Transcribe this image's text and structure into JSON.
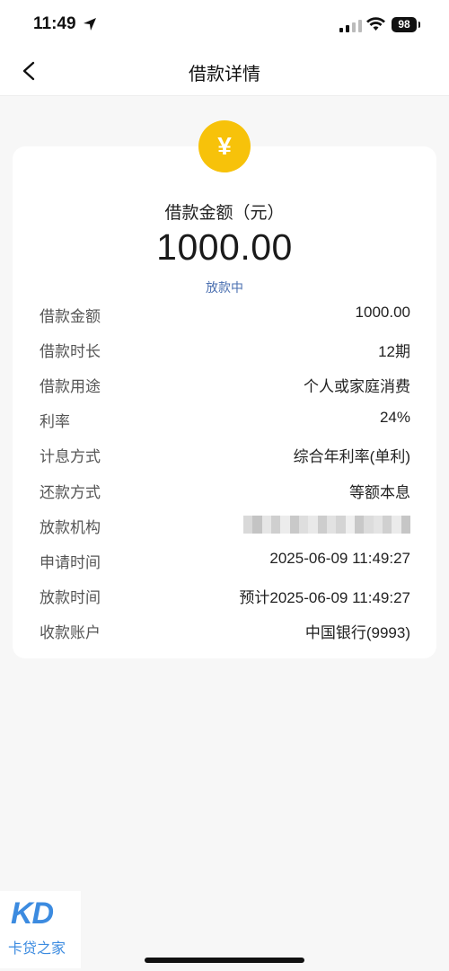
{
  "status": {
    "time": "11:49",
    "battery": "98",
    "location_icon": "location-arrow-icon",
    "signal_icon": "cellular-signal-icon",
    "wifi_icon": "wifi-icon"
  },
  "nav": {
    "title": "借款详情",
    "back_icon": "chevron-left-icon"
  },
  "loan": {
    "icon": "yen-coin-icon",
    "coin_symbol": "¥",
    "amount_label": "借款金额（元）",
    "amount": "1000.00",
    "status": "放款中"
  },
  "details": [
    {
      "label": "借款金额",
      "value": "1000.00"
    },
    {
      "label": "借款时长",
      "value": "12期"
    },
    {
      "label": "借款用途",
      "value": "个人或家庭消费"
    },
    {
      "label": "利率",
      "value": "24%"
    },
    {
      "label": "计息方式",
      "value": "综合年利率(单利)"
    },
    {
      "label": "还款方式",
      "value": "等额本息"
    },
    {
      "label": "放款机构",
      "value": ""
    },
    {
      "label": "申请时间",
      "value": "2025-06-09 11:49:27"
    },
    {
      "label": "放款时间",
      "value": "预计2025-06-09 11:49:27"
    },
    {
      "label": "收款账户",
      "value": "中国银行(9993)"
    }
  ],
  "watermark": {
    "logo": "KD",
    "text": "卡贷之家"
  },
  "colors": {
    "accent": "#f7c20a",
    "status_blue": "#4a6fb0",
    "watermark_blue": "#3c8be0",
    "background": "#f7f7f7"
  }
}
